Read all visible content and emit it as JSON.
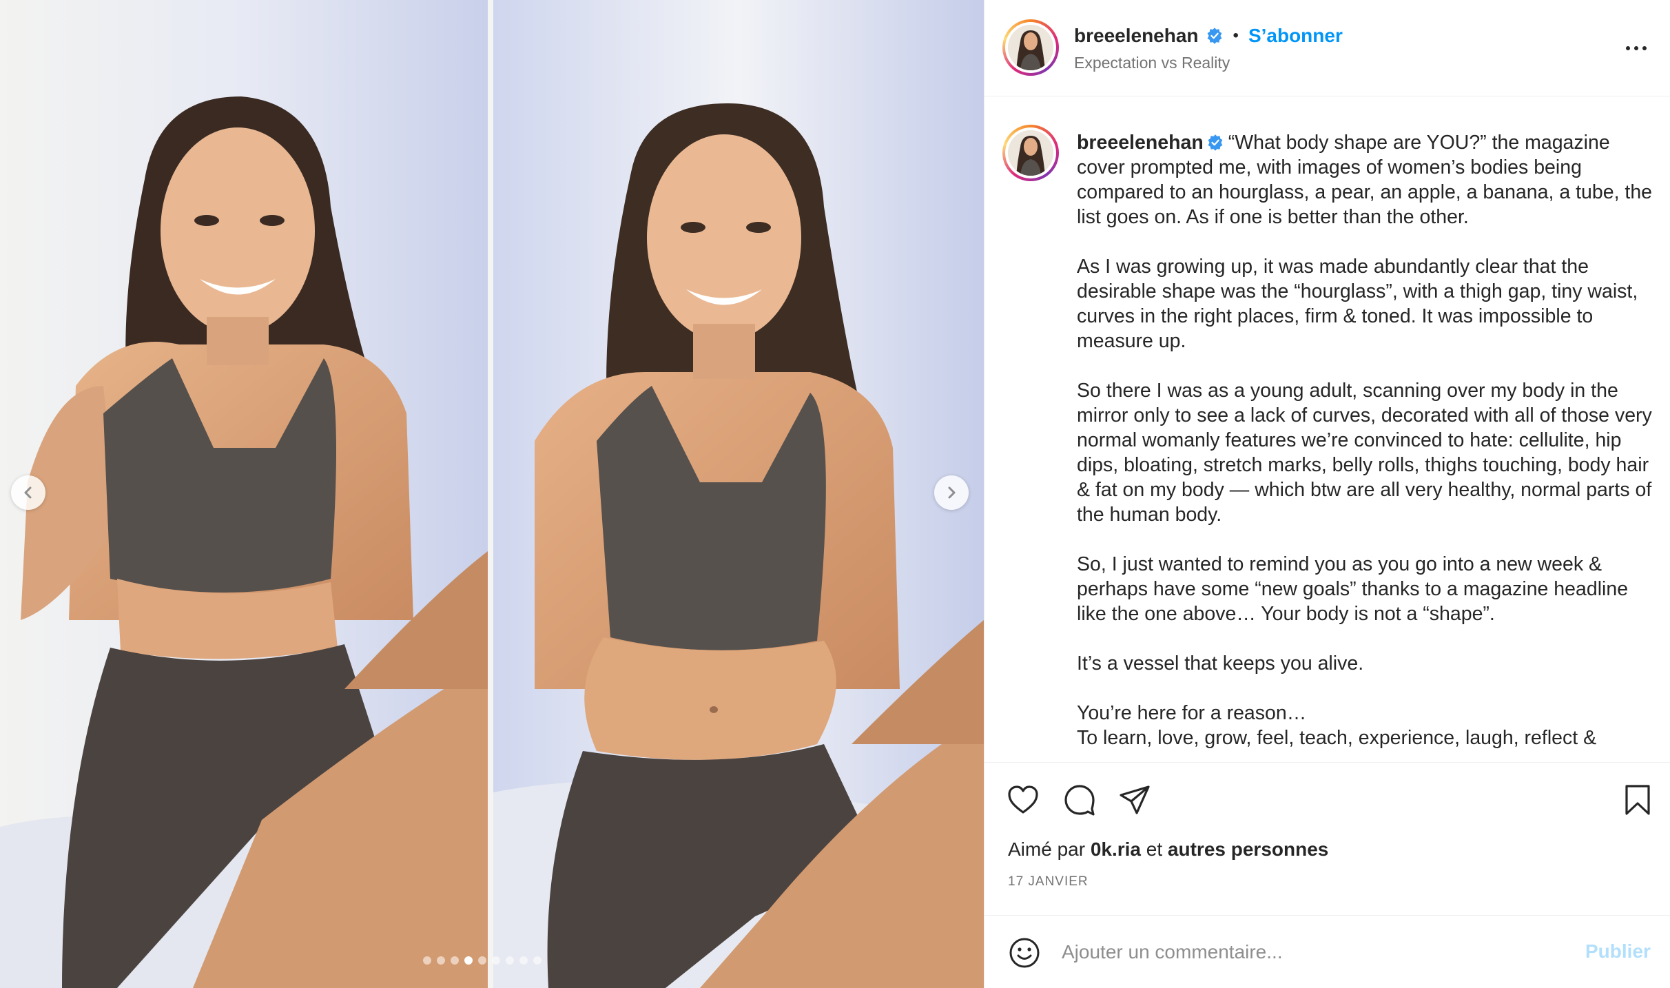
{
  "post": {
    "username": "breeelenehan",
    "follow_label": "S’abonner",
    "separator": "•",
    "subtitle": "Expectation vs Reality"
  },
  "carousel": {
    "dot_count": 9,
    "active_index": 3
  },
  "caption": {
    "username": "breeelenehan",
    "paragraphs": [
      "“What body shape are YOU?” the magazine cover prompted me, with images of women’s bodies being compared to an hourglass, a pear, an apple, a banana, a tube, the list goes on. As if one is better than the other.",
      "As I was growing up, it was made abundantly clear that the desirable shape was the “hourglass”, with a thigh gap, tiny waist, curves in the right places, firm & toned. It was impossible to measure up.",
      "So there I was as a young adult, scanning over my body in the mirror only to see a lack of curves, decorated with all of those very normal womanly features we’re convinced to hate: cellulite, hip dips, bloating, stretch marks, belly rolls, thighs touching, body hair & fat on my body — which btw are all very healthy, normal parts of the human body.",
      "So, I just wanted to remind you as you go into a new week & perhaps have some “new goals” thanks to a magazine headline like the one above… Your body is not a “shape”.",
      "It’s a vessel that keeps you alive.",
      "You’re here for a reason…",
      "To learn, love, grow, feel, teach, experience, laugh, reflect &"
    ]
  },
  "likes": {
    "prefix": "Aimé par",
    "user": "0k.ria",
    "conjunction": "et",
    "others": "autres personnes"
  },
  "date": "17 JANVIER",
  "comment": {
    "placeholder": "Ajouter un commentaire...",
    "publish_label": "Publier"
  },
  "colors": {
    "link_blue": "#0095f6",
    "publish_disabled": "#b2dffc",
    "verified_blue": "#3897f0",
    "muted_text": "#737373"
  },
  "icons": [
    "chevron-left-icon",
    "chevron-right-icon",
    "verified-badge-icon",
    "more-options-icon",
    "heart-icon",
    "comment-icon",
    "share-icon",
    "bookmark-icon",
    "emoji-icon"
  ]
}
